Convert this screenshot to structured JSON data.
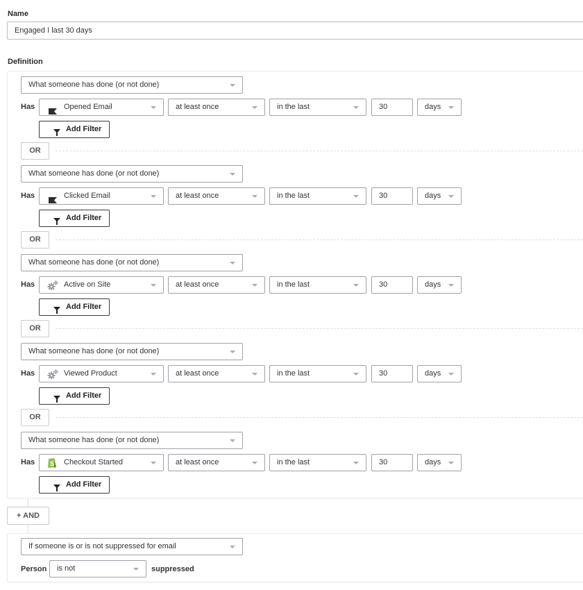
{
  "name": {
    "label": "Name",
    "value": "Engaged I last 30 days"
  },
  "definition": {
    "label": "Definition",
    "or_label": "OR",
    "and_label": "+ AND",
    "add_filter_label": "Add Filter",
    "has_label": "Has",
    "condition_groups": [
      {
        "type": "What someone has done (or not done)",
        "metric": "Opened Email",
        "metric_icon": "flag-icon",
        "frequency": "at least once",
        "timeframe": "in the last",
        "amount": "30",
        "unit": "days"
      },
      {
        "type": "What someone has done (or not done)",
        "metric": "Clicked Email",
        "metric_icon": "flag-icon",
        "frequency": "at least once",
        "timeframe": "in the last",
        "amount": "30",
        "unit": "days"
      },
      {
        "type": "What someone has done (or not done)",
        "metric": "Active on Site",
        "metric_icon": "gears-icon",
        "frequency": "at least once",
        "timeframe": "in the last",
        "amount": "30",
        "unit": "days"
      },
      {
        "type": "What someone has done (or not done)",
        "metric": "Viewed Product",
        "metric_icon": "gears-icon",
        "frequency": "at least once",
        "timeframe": "in the last",
        "amount": "30",
        "unit": "days"
      },
      {
        "type": "What someone has done (or not done)",
        "metric": "Checkout Started",
        "metric_icon": "shopify-icon",
        "frequency": "at least once",
        "timeframe": "in the last",
        "amount": "30",
        "unit": "days"
      }
    ],
    "suppression": {
      "type": "If someone is or is not suppressed for email",
      "person_label": "Person",
      "operator": "is not",
      "suffix": "suppressed"
    }
  },
  "colors": {
    "shopify_green": "#95bf47",
    "icon_dark": "#2d2d2d",
    "gear_gray": "#9a9ca0"
  }
}
